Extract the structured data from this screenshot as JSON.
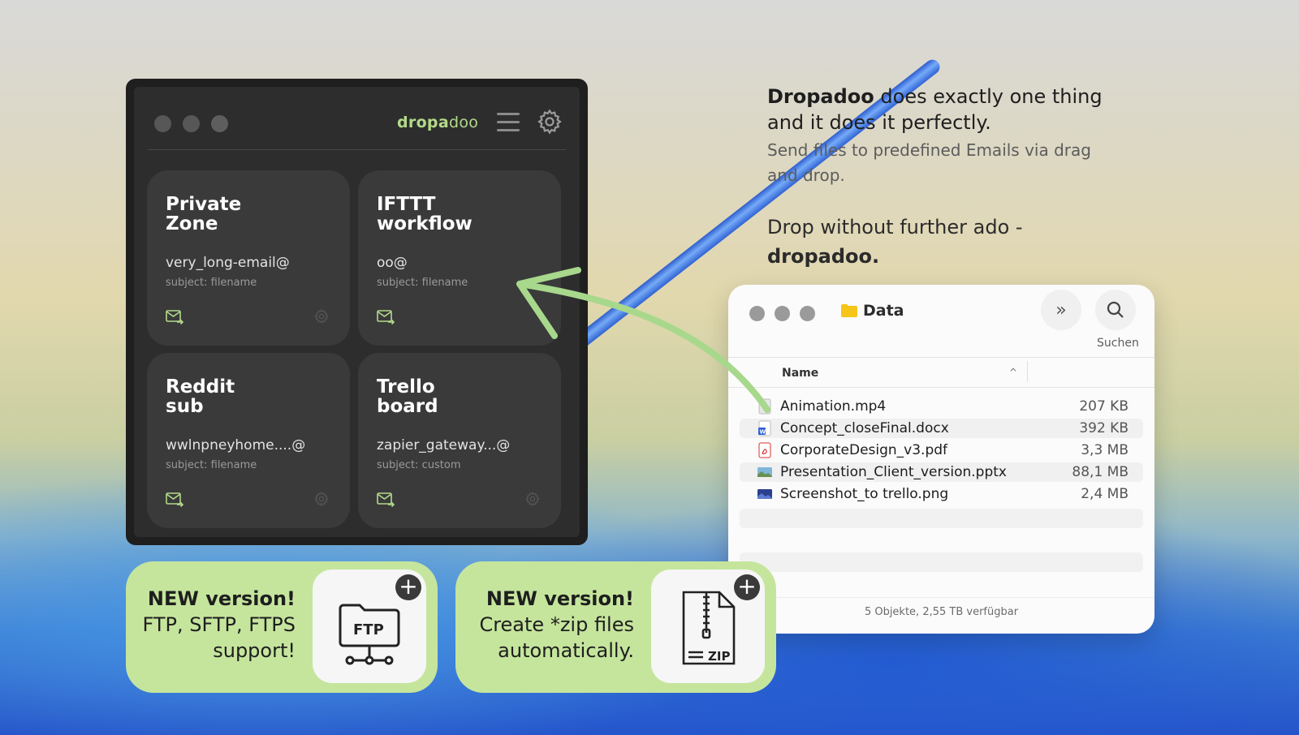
{
  "app": {
    "brand_bold": "dropa",
    "brand_rest": "doo",
    "icons": {
      "menu": "hamburger-icon",
      "settings": "gear-icon",
      "mail": "mail-send-icon"
    },
    "accent": "#b3da8a",
    "cards": [
      {
        "title": "Private\nZone",
        "email": "very_long-email@",
        "subject": "subject: filename"
      },
      {
        "title": "IFTTT\nworkflow",
        "email": "oo@",
        "subject": "subject: filename"
      },
      {
        "title": "Reddit\nsub",
        "email": "wwlnpneyhome....@",
        "subject": "subject: filename"
      },
      {
        "title": "Trello\nboard",
        "email": "zapier_gateway...@",
        "subject": "subject: custom"
      }
    ]
  },
  "promo": {
    "headline_bold": "Dropadoo",
    "headline_rest": " does exactly one thing and it does it perfectly.",
    "sub": "Send files to predefined Emails via drag and drop.",
    "tagline_pre": "Drop without further ado - ",
    "tagline_bold": "dropadoo."
  },
  "finder": {
    "title": "Data",
    "search_label": "Suchen",
    "column_name": "Name",
    "files": [
      {
        "name": "Animation.mp4",
        "size": "207 KB",
        "icon": "video-file-icon"
      },
      {
        "name": "Concept_closeFinal.docx",
        "size": "392 KB",
        "icon": "word-file-icon"
      },
      {
        "name": "CorporateDesign_v3.pdf",
        "size": "3,3 MB",
        "icon": "pdf-file-icon"
      },
      {
        "name": "Presentation_Client_version.pptx",
        "size": "88,1 MB",
        "icon": "image-file-icon"
      },
      {
        "name": "Screenshot_to trello.png",
        "size": "2,4 MB",
        "icon": "image-file-icon"
      }
    ],
    "status": "5 Objekte, 2,55 TB verfügbar"
  },
  "badges": [
    {
      "title": "NEW version!",
      "line1": "FTP, SFTP, FTPS",
      "line2": "support!",
      "icon": "ftp-icon",
      "icon_label": "FTP"
    },
    {
      "title": "NEW version!",
      "line1": "Create *zip files",
      "line2": "automatically.",
      "icon": "zip-file-icon",
      "icon_label": "ZIP"
    }
  ]
}
